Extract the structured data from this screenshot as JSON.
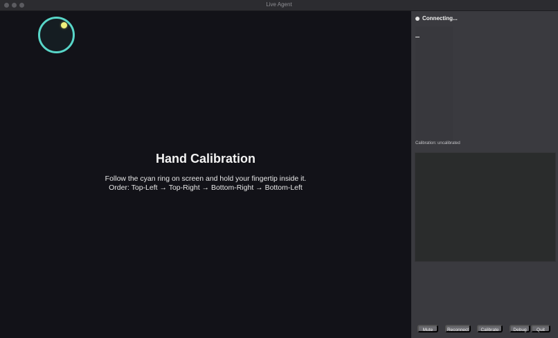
{
  "window": {
    "title": "Live Agent"
  },
  "calibration": {
    "title": "Hand Calibration",
    "instruction": "Follow the cyan ring on screen and hold your fingertip inside it.",
    "order": "Order:  Top-Left  →  Top-Right  →  Bottom-Right  →  Bottom-Left",
    "ring_color": "#58d6c8",
    "dot_color": "#eef07c"
  },
  "sidebar": {
    "status": "Connecting...",
    "transcript_cursor": "_",
    "calibration_status": "Calibration: uncalibrated",
    "buttons": {
      "mute": "Mute",
      "reconnect": "Reconnect",
      "calibrate": "Calibrate",
      "debug": "Debug",
      "quit": "Quit"
    }
  }
}
